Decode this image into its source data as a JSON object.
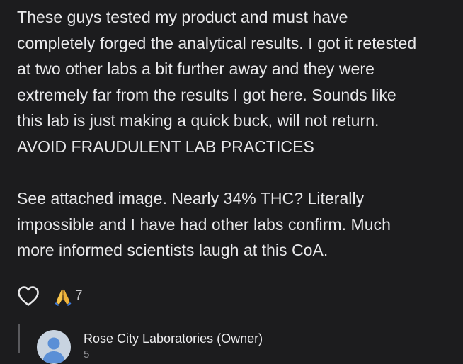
{
  "review": {
    "lines": [
      "These guys tested my product and must have",
      "completely forged the analytical results. I got it retested",
      "at two other labs a bit further away and they were",
      "extremely far from the results I got here. Sounds like",
      "this lab is just making a quick buck, will not return.",
      "AVOID FRAUDULENT LAB PRACTICES",
      "See attached image. Nearly 34% THC? Literally",
      "impossible and I have had other labs confirm. Much",
      "more informed scientists laugh at this CoA."
    ]
  },
  "actions": {
    "like_icon": "heart-outline-icon",
    "reaction_icon": "folded-hands-emoji",
    "reaction_count": "7"
  },
  "reply": {
    "author": "Rose City Laboratories (Owner)",
    "subline": "5",
    "avatar_icon": "default-person-avatar"
  },
  "colors": {
    "background": "#1c1c1e",
    "text": "#e8e8ea",
    "muted": "#8e8e93",
    "thread_line": "#5a5a5e",
    "avatar_bg": "#c8d3e0",
    "avatar_fg": "#5b8fd6"
  }
}
